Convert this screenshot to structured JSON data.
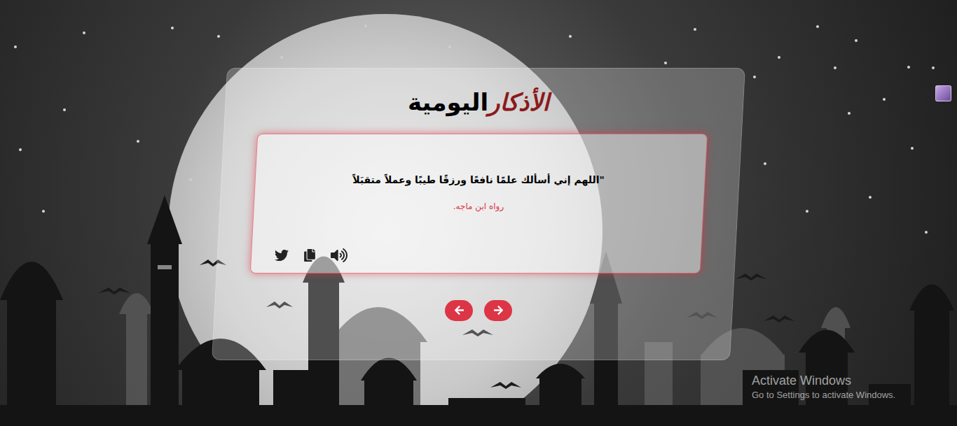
{
  "title": {
    "highlight": "الأذكار",
    "rest": "اليومية"
  },
  "dhikr": {
    "text": "\"اللهم إني أسألك علمًا نافعًا ورزقًا طيبًا وعملاً متقبَلاً",
    "source": "رواه ابن ماجه."
  },
  "watermark": {
    "title": "Activate Windows",
    "subtitle": "Go to Settings to activate Windows."
  }
}
